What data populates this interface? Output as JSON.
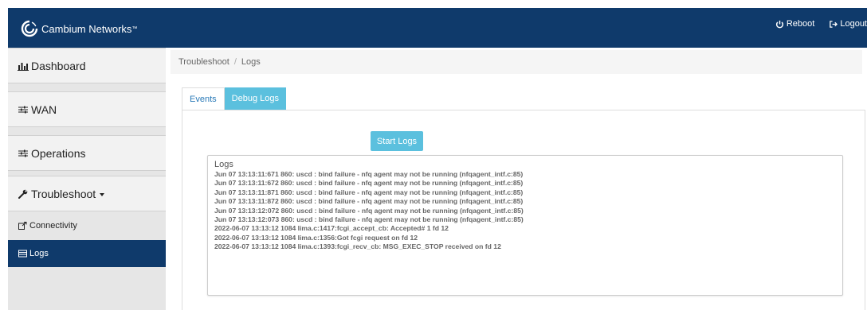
{
  "header": {
    "brand": "Cambium Networks",
    "brand_mark": "™",
    "reboot_label": "Reboot",
    "logout_label": "Logout",
    "colors": {
      "topbar": "#0f3a6b",
      "accent": "#5bc0de"
    }
  },
  "sidebar": {
    "items": [
      {
        "label": "Dashboard",
        "icon": "bar-chart-icon"
      },
      {
        "label": "WAN",
        "icon": "sliders-icon"
      },
      {
        "label": "Operations",
        "icon": "sliders-icon"
      },
      {
        "label": "Troubleshoot",
        "icon": "wrench-icon"
      }
    ],
    "subitems": [
      {
        "label": "Connectivity",
        "icon": "external-link-icon",
        "active": false
      },
      {
        "label": "Logs",
        "icon": "list-icon",
        "active": true
      }
    ]
  },
  "breadcrumb": {
    "parent": "Troubleshoot",
    "separator": "/",
    "current": "Logs"
  },
  "tabs": [
    {
      "label": "Events",
      "active": false
    },
    {
      "label": "Debug Logs",
      "active": true
    }
  ],
  "logs": {
    "start_button": "Start Logs",
    "title": "Logs",
    "lines": [
      "Jun 07 13:13:11:671 860: uscd : bind failure - nfq agent may not be running (nfqagent_intf.c:85)",
      "Jun 07 13:13:11:672 860: uscd : bind failure - nfq agent may not be running (nfqagent_intf.c:85)",
      "Jun 07 13:13:11:871 860: uscd : bind failure - nfq agent may not be running (nfqagent_intf.c:85)",
      "Jun 07 13:13:11:872 860: uscd : bind failure - nfq agent may not be running (nfqagent_intf.c:85)",
      "Jun 07 13:13:12:072 860: uscd : bind failure - nfq agent may not be running (nfqagent_intf.c:85)",
      "Jun 07 13:13:12:073 860: uscd : bind failure - nfq agent may not be running (nfqagent_intf.c:85)",
      "2022-06-07 13:13:12 1084 lima.c:1417:fcgi_accept_cb: Accepted# 1 fd 12",
      "2022-06-07 13:13:12 1084 lima.c:1356:Got fcgi request on fd 12",
      "2022-06-07 13:13:12 1084 lima.c:1393:fcgi_recv_cb: MSG_EXEC_STOP received on fd 12"
    ]
  }
}
